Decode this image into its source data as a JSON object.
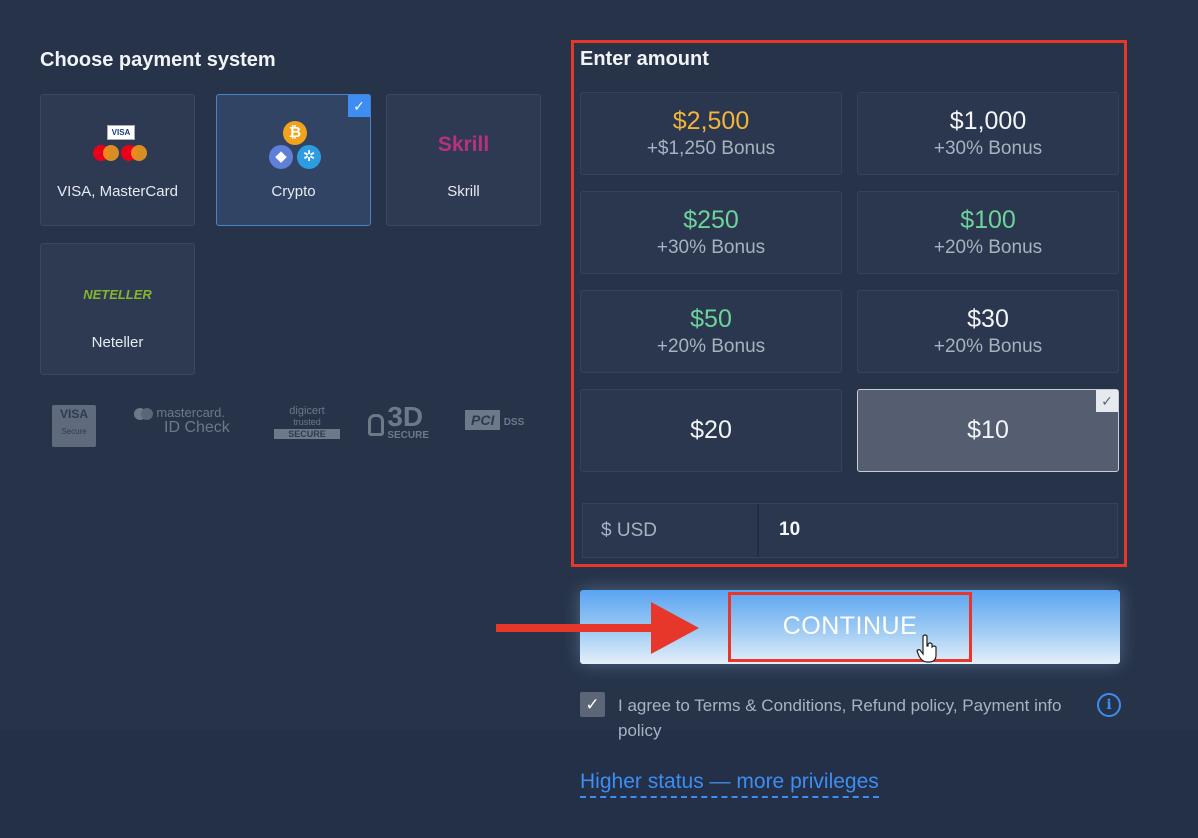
{
  "left_panel": {
    "title": "Choose payment system",
    "methods": [
      {
        "label": "VISA, MasterCard",
        "icon": "visa-mastercard-icon",
        "selected": false
      },
      {
        "label": "Crypto",
        "icon": "crypto-icon",
        "selected": true
      },
      {
        "label": "Skrill",
        "icon": "skrill-logo",
        "selected": false
      },
      {
        "label": "Neteller",
        "icon": "neteller-logo",
        "selected": false
      }
    ],
    "logos": {
      "visa": "VISA",
      "visa_sub": "Secure",
      "mastercard": "mastercard.",
      "mastercard_sub": "ID Check",
      "digicert": "digicert",
      "digicert_sub": "trusted",
      "digicert_badge": "SECURE",
      "threed": "3D",
      "threed_sub": "SECURE",
      "pci": "PCI",
      "pci_sub": "DSS"
    },
    "skrill_text": "Skrill",
    "neteller_text": "NETELLER",
    "visa_badge": "VISA"
  },
  "amount_panel": {
    "title": "Enter amount",
    "options": [
      {
        "value": "$2,500",
        "bonus": "+$1,250 Bonus",
        "highlight": "gold"
      },
      {
        "value": "$1,000",
        "bonus": "+30% Bonus",
        "highlight": "none"
      },
      {
        "value": "$250",
        "bonus": "+30% Bonus",
        "highlight": "green"
      },
      {
        "value": "$100",
        "bonus": "+20% Bonus",
        "highlight": "green"
      },
      {
        "value": "$50",
        "bonus": "+20% Bonus",
        "highlight": "green"
      },
      {
        "value": "$30",
        "bonus": "+20% Bonus",
        "highlight": "none"
      },
      {
        "value": "$20",
        "bonus": "",
        "highlight": "none"
      },
      {
        "value": "$10",
        "bonus": "",
        "highlight": "none",
        "selected": true
      }
    ],
    "currency_label": "$ USD",
    "amount_value": "10"
  },
  "continue_label": "CONTINUE",
  "agreement": {
    "checked": true,
    "text": "I agree to Terms & Conditions, Refund policy, Payment info policy"
  },
  "status_link": "Higher status — more privileges",
  "colors": {
    "accent": "#3d8df2",
    "highlight_red": "#e6372a",
    "gold": "#f2b43c",
    "green": "#6dd39a"
  }
}
